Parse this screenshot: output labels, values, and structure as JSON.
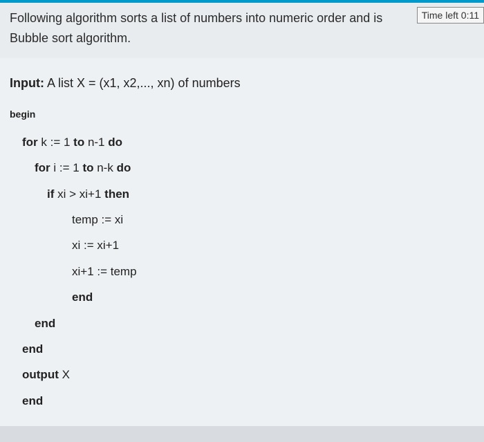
{
  "header": {
    "question_line1": "Following algorithm sorts a list of numbers into numeric order and is",
    "question_line2": "Bubble sort algorithm.",
    "time_label": "Time left 0:11"
  },
  "content": {
    "input_label": "Input:",
    "input_text": " A list X = (x1, x2,..., xn) of numbers",
    "begin": "begin",
    "lines": [
      {
        "indent": 1,
        "segments": [
          {
            "t": "for",
            "b": true
          },
          {
            "t": " k := 1 ",
            "b": false
          },
          {
            "t": "to",
            "b": true
          },
          {
            "t": " n-1 ",
            "b": false
          },
          {
            "t": "do",
            "b": true
          }
        ]
      },
      {
        "indent": 2,
        "segments": [
          {
            "t": "for",
            "b": true
          },
          {
            "t": " i := 1 ",
            "b": false
          },
          {
            "t": "to",
            "b": true
          },
          {
            "t": " n-k ",
            "b": false
          },
          {
            "t": "do",
            "b": true
          }
        ]
      },
      {
        "indent": 3,
        "segments": [
          {
            "t": "if",
            "b": true
          },
          {
            "t": " xi > xi+1 ",
            "b": false
          },
          {
            "t": "then",
            "b": true
          }
        ]
      },
      {
        "indent": 4,
        "segments": [
          {
            "t": "temp := xi",
            "b": false
          }
        ]
      },
      {
        "indent": 4,
        "segments": [
          {
            "t": "xi := xi+1",
            "b": false
          }
        ]
      },
      {
        "indent": 4,
        "segments": [
          {
            "t": "xi+1 := temp",
            "b": false
          }
        ]
      },
      {
        "indent": 4,
        "segments": [
          {
            "t": "end",
            "b": true
          }
        ]
      },
      {
        "indent": 2,
        "segments": [
          {
            "t": "end",
            "b": true
          }
        ]
      },
      {
        "indent": 1,
        "segments": [
          {
            "t": "end",
            "b": true
          }
        ]
      },
      {
        "indent": 1,
        "segments": [
          {
            "t": "output",
            "b": true
          },
          {
            "t": " X",
            "b": false
          }
        ]
      },
      {
        "indent": 1,
        "segments": [
          {
            "t": "end",
            "b": true
          }
        ]
      }
    ]
  }
}
